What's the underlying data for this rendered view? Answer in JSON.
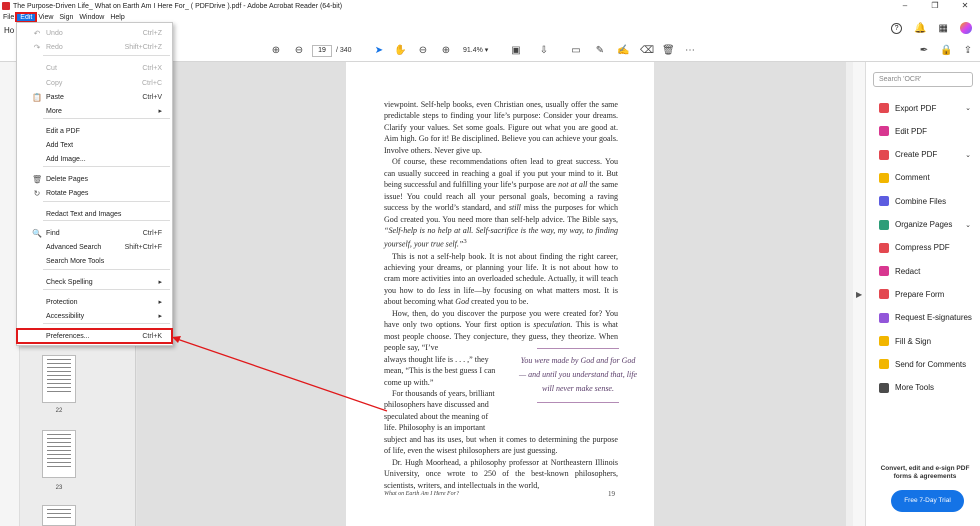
{
  "window": {
    "title": "The Purpose-Driven Life_ What on Earth Am I Here For_ ( PDFDrive ).pdf - Adobe Acrobat Reader (64-bit)",
    "controls": [
      "–",
      "❐",
      "✕"
    ]
  },
  "menubar": [
    "File",
    "Edit",
    "View",
    "Sign",
    "Window",
    "Help"
  ],
  "tabs": {
    "home": "Ho"
  },
  "toolbar": {
    "page_current": "19",
    "page_total": "/ 340",
    "zoom": "91.4%"
  },
  "edit_menu": {
    "items": [
      {
        "label": "Undo",
        "shortcut": "Ctrl+Z",
        "icon": "undo-icon",
        "glyph": "↶",
        "disabled": true
      },
      {
        "label": "Redo",
        "shortcut": "Shift+Ctrl+Z",
        "icon": "redo-icon",
        "glyph": "↷",
        "disabled": true
      },
      {
        "label": "Cut",
        "shortcut": "Ctrl+X",
        "disabled": true
      },
      {
        "label": "Copy",
        "shortcut": "Ctrl+C",
        "disabled": true
      },
      {
        "label": "Paste",
        "shortcut": "Ctrl+V",
        "icon": "clipboard-icon",
        "glyph": "📋",
        "disabled": false
      },
      {
        "label": "More",
        "submenu": true,
        "disabled": false
      },
      {
        "label": "Edit a PDF",
        "disabled": false
      },
      {
        "label": "Add Text",
        "disabled": false
      },
      {
        "label": "Add Image...",
        "disabled": false
      },
      {
        "label": "Delete Pages",
        "icon": "trash-icon",
        "glyph": "🗑",
        "disabled": false
      },
      {
        "label": "Rotate Pages",
        "icon": "rotate-icon",
        "glyph": "↻",
        "disabled": false
      },
      {
        "label": "Redact Text and Images",
        "disabled": false
      },
      {
        "label": "Find",
        "shortcut": "Ctrl+F",
        "icon": "search-icon",
        "glyph": "🔍",
        "disabled": false
      },
      {
        "label": "Advanced Search",
        "shortcut": "Shift+Ctrl+F",
        "disabled": false
      },
      {
        "label": "Search More Tools",
        "disabled": false
      },
      {
        "label": "Check Spelling",
        "submenu": true,
        "disabled": false
      },
      {
        "label": "Protection",
        "submenu": true,
        "disabled": false
      },
      {
        "label": "Accessibility",
        "submenu": true,
        "disabled": false
      },
      {
        "label": "Preferences...",
        "shortcut": "Ctrl+K",
        "disabled": false,
        "highlighted": true
      }
    ]
  },
  "thumbnails": [
    "22",
    "23"
  ],
  "page": {
    "paragraphs": [
      "viewpoint. Self-help books, even Christian ones, usually offer the same predictable steps to finding your life’s purpose: Consider your dreams. Clarify your values. Set some goals. Figure out what you are good at. Aim high. Go for it! Be disciplined. Believe you can achieve your goals. Involve others. Never give up."
    ],
    "text_html": "",
    "pullquote": "You were made by God and for God — and until you understand that, life will never make sense.",
    "running_head": "What on Earth Am I Here For?",
    "page_number": "19"
  },
  "right_panel": {
    "search_placeholder": "Search 'OCR'",
    "tools": [
      {
        "label": "Export PDF",
        "color": "#e34850",
        "chevron": true
      },
      {
        "label": "Edit PDF",
        "color": "#d83790",
        "chevron": false
      },
      {
        "label": "Create PDF",
        "color": "#e34850",
        "chevron": true
      },
      {
        "label": "Comment",
        "color": "#f2b600",
        "chevron": false
      },
      {
        "label": "Combine Files",
        "color": "#5c5ce0",
        "chevron": false
      },
      {
        "label": "Organize Pages",
        "color": "#2d9d78",
        "chevron": true
      },
      {
        "label": "Compress PDF",
        "color": "#e34850",
        "chevron": false
      },
      {
        "label": "Redact",
        "color": "#d83790",
        "chevron": false
      },
      {
        "label": "Prepare Form",
        "color": "#e34850",
        "chevron": false
      },
      {
        "label": "Request E-signatures",
        "color": "#9256d9",
        "chevron": false
      },
      {
        "label": "Fill & Sign",
        "color": "#f2b600",
        "chevron": false
      },
      {
        "label": "Send for Comments",
        "color": "#f2b600",
        "chevron": false
      },
      {
        "label": "More Tools",
        "color": "#4b4b4b",
        "chevron": false
      }
    ],
    "promo": "Convert, edit and e-sign PDF forms & agreements",
    "trial_button": "Free 7-Day Trial"
  }
}
